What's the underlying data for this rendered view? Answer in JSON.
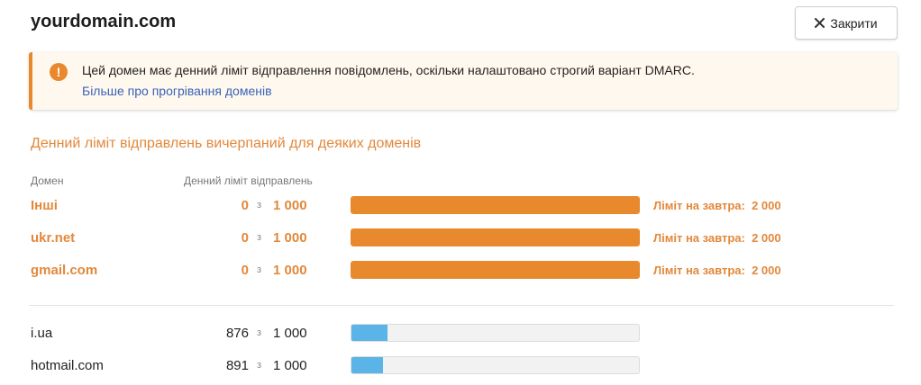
{
  "header": {
    "title": "yourdomain.com",
    "close_label": "Закрити"
  },
  "alert": {
    "message": "Цей домен має денний ліміт відправлення повідомлень, оскільки налаштовано строгий варіант DMARC.",
    "link": "Більше про прогрівання доменів",
    "accent_color": "#e8892e"
  },
  "section_title": "Денний ліміт відправлень вичерпаний для деяких доменів",
  "columns": {
    "domain": "Домен",
    "limit": "Денний ліміт відправлень"
  },
  "of_label": "з",
  "tomorrow_label": "Ліміт на завтра:",
  "limited_rows": [
    {
      "domain": "Інші",
      "used": "0",
      "total": "1 000",
      "remaining_fraction": 1.0,
      "tomorrow": "2 000"
    },
    {
      "domain": "ukr.net",
      "used": "0",
      "total": "1 000",
      "remaining_fraction": 1.0,
      "tomorrow": "2 000"
    },
    {
      "domain": "gmail.com",
      "used": "0",
      "total": "1 000",
      "remaining_fraction": 1.0,
      "tomorrow": "2 000"
    }
  ],
  "normal_rows": [
    {
      "domain": "i.ua",
      "used": "876",
      "total": "1 000",
      "fill_fraction": 0.124
    },
    {
      "domain": "hotmail.com",
      "used": "891",
      "total": "1 000",
      "fill_fraction": 0.109
    }
  ],
  "colors": {
    "limited": "#e8892e",
    "normal_bar": "#5ab4e8",
    "link": "#3a63b8"
  }
}
